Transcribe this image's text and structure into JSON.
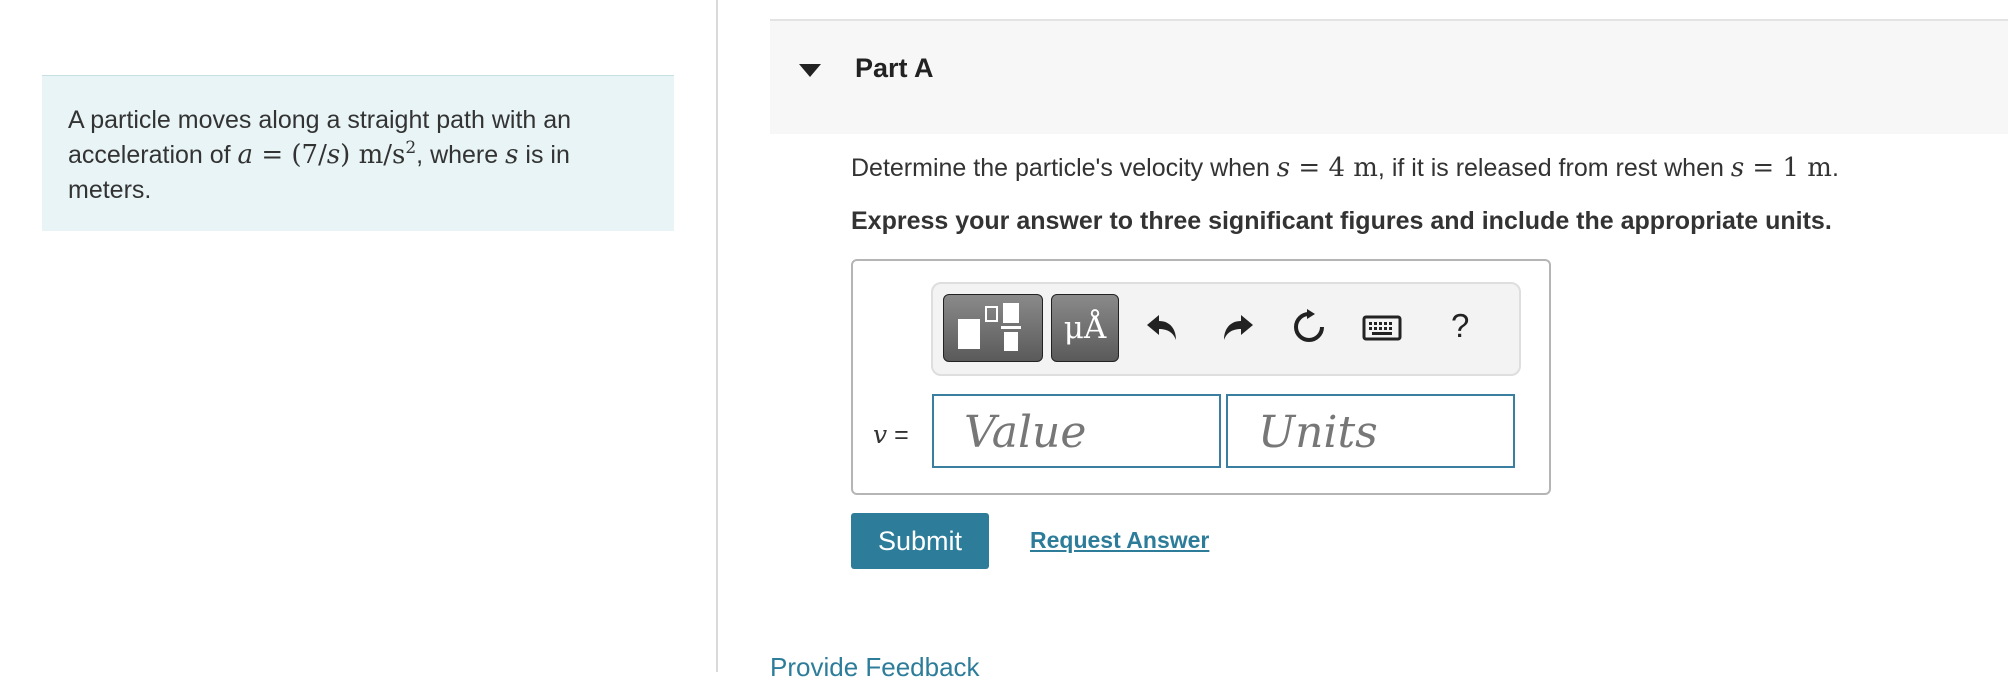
{
  "problem": {
    "text_1": "A particle moves along a straight path with an acceleration of ",
    "a_var": "a",
    "eq": " = (7/",
    "s_var": "s",
    "eq_close": ")  m/s",
    "exp": "2",
    "text_2": ", where ",
    "s_var2": "s",
    "text_3": " is in meters."
  },
  "part": {
    "title": "Part A",
    "question_1": "Determine the particle's velocity when ",
    "q_var1": "s",
    "q_eq1": " = 4 m",
    "question_2": ", if it is released from rest when ",
    "q_var2": "s",
    "q_eq2": " = 1 m",
    "question_3": ".",
    "instruction": "Express your answer to three significant figures and include the appropriate units."
  },
  "toolbar": {
    "templates_icon": "templates-icon",
    "symbols_label": "μÅ",
    "help_label": "?"
  },
  "answer": {
    "variable": "v",
    "equals": " =",
    "value_placeholder": "Value",
    "units_placeholder": "Units"
  },
  "actions": {
    "submit": "Submit",
    "request_answer": "Request Answer",
    "feedback": "Provide Feedback"
  },
  "colors": {
    "accent": "#2d7d9a",
    "problem_bg": "#e8f4f5"
  }
}
